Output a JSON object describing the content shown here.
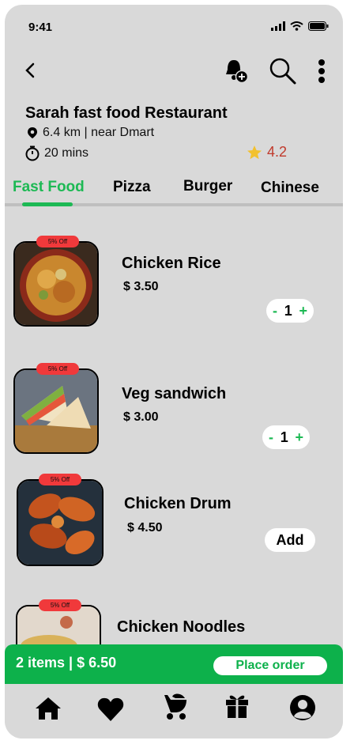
{
  "status": {
    "time": "9:41"
  },
  "restaurant": {
    "name": "Sarah fast food Restaurant",
    "distance": "6.4 km | near Dmart",
    "time": "20 mins",
    "rating": "4.2"
  },
  "tabs": [
    {
      "label": "Fast Food",
      "active": true
    },
    {
      "label": "Pizza"
    },
    {
      "label": "Burger"
    },
    {
      "label": "Chinese"
    }
  ],
  "items": [
    {
      "badge": "5% Off",
      "name": "Chicken Rice",
      "price": "$ 3.50",
      "qty": "1",
      "minus": "-",
      "plus": "+"
    },
    {
      "badge": "5% Off",
      "name": "Veg sandwich",
      "price": "$ 3.00",
      "qty": "1",
      "minus": "-",
      "plus": "+"
    },
    {
      "badge": "5% Off",
      "name": "Chicken Drum",
      "price": "$ 4.50",
      "add_label": "Add"
    },
    {
      "badge": "5% Off",
      "name": "Chicken Noodles"
    }
  ],
  "order": {
    "summary": "2 items | $ 6.50",
    "button": "Place order"
  },
  "colors": {
    "accent": "#1db954",
    "order_bar": "#0db14b",
    "badge": "#f0393b",
    "rating": "#c0392b",
    "star": "#f2c12e"
  },
  "icons": [
    "back-icon",
    "bell-add-icon",
    "search-icon",
    "more-icon",
    "location-icon",
    "clock-icon",
    "star-icon",
    "home-icon",
    "heart-icon",
    "stroller-icon",
    "gift-icon",
    "profile-icon"
  ]
}
